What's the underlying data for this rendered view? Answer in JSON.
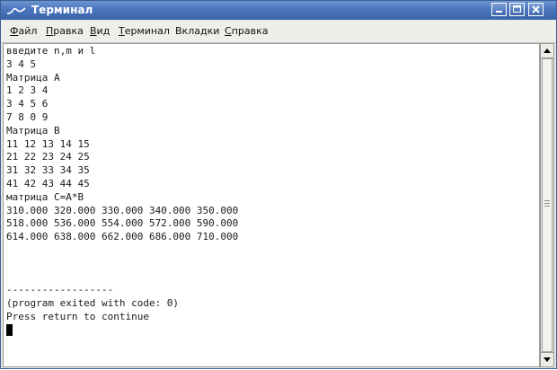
{
  "window": {
    "title": "Терминал"
  },
  "menu": {
    "items": [
      {
        "first": "Ф",
        "rest": "айл"
      },
      {
        "first": "П",
        "rest": "равка"
      },
      {
        "first": "В",
        "rest": "ид"
      },
      {
        "first": "Т",
        "rest": "ерминал"
      },
      {
        "first": "",
        "rest": "Вкладки"
      },
      {
        "first": "С",
        "rest": "правка"
      }
    ]
  },
  "terminal": {
    "lines": [
      "введите n,m и l",
      "3 4 5",
      "Матрица A",
      "1 2 3 4",
      "3 4 5 6",
      "7 8 0 9",
      "Матрица B",
      "11 12 13 14 15",
      "21 22 23 24 25",
      "31 32 33 34 35",
      "41 42 43 44 45",
      "матрица C=A*B",
      "310.000 320.000 330.000 340.000 350.000",
      "518.000 536.000 554.000 572.000 590.000",
      "614.000 638.000 662.000 686.000 710.000",
      "",
      "",
      "",
      "------------------",
      "(program exited with code: 0)",
      "Press return to continue"
    ]
  },
  "icons": {
    "window_icon": "terminal-wave-icon",
    "minimize": "minimize-icon",
    "maximize": "maximize-icon",
    "close": "close-icon"
  },
  "colors": {
    "titlebar": "#4a76bd",
    "title_text": "#ffffff",
    "terminal_bg": "#ffffff",
    "terminal_text": "#1a1a1a"
  }
}
